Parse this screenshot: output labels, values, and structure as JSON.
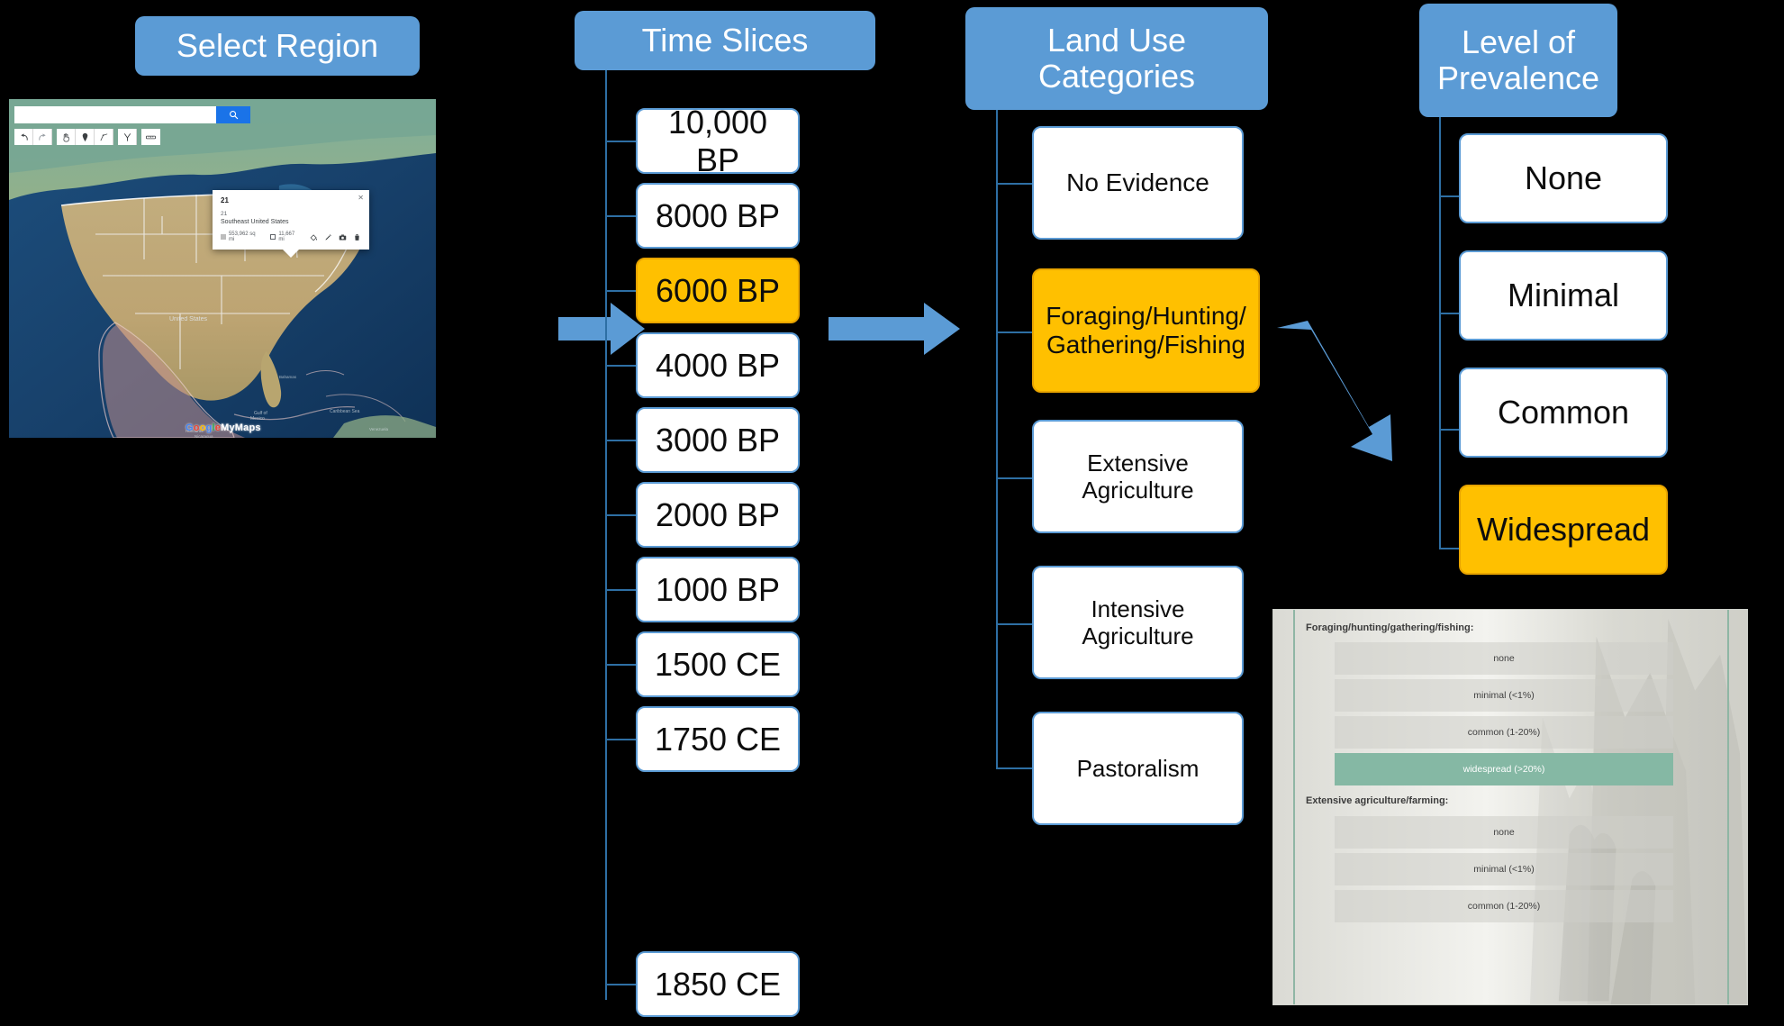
{
  "columns": {
    "region": {
      "header": "Select Region",
      "map": {
        "search_value": "",
        "search_placeholder": "",
        "search_icon": "search-icon",
        "tools": [
          "undo-icon",
          "redo-icon",
          "pan-hand-icon",
          "marker-pin-icon",
          "draw-line-icon",
          "directions-icon",
          "ruler-icon"
        ],
        "popup": {
          "title": "21",
          "subtitle": "21",
          "name": "Southeast United States",
          "area": "553,962 sq mi",
          "perimeter": "11,667 mi",
          "close_icon": "close-icon",
          "action_icons": [
            "paint-bucket-icon",
            "pencil-icon",
            "camera-icon",
            "trash-icon"
          ]
        },
        "watermark": "Google My Maps"
      }
    },
    "time_slices": {
      "header": "Time Slices",
      "items": [
        {
          "label": "10,000 BP",
          "selected": false
        },
        {
          "label": "8000 BP",
          "selected": false
        },
        {
          "label": "6000 BP",
          "selected": true
        },
        {
          "label": "4000 BP",
          "selected": false
        },
        {
          "label": "3000 BP",
          "selected": false
        },
        {
          "label": "2000 BP",
          "selected": false
        },
        {
          "label": "1000 BP",
          "selected": false
        },
        {
          "label": "1500 CE",
          "selected": false
        },
        {
          "label": "1750 CE",
          "selected": false
        },
        {
          "label": "1850 CE",
          "selected": false
        }
      ]
    },
    "land_use": {
      "header": "Land Use Categories",
      "header_line1": "Land Use",
      "header_line2": "Categories",
      "items": [
        {
          "label": "No Evidence",
          "selected": false
        },
        {
          "label": "Foraging/Hunting/Gathering/Fishing",
          "line1": "Foraging/Hunting/",
          "line2": "Gathering/Fishing",
          "selected": true
        },
        {
          "label": "Extensive Agriculture",
          "line1": "Extensive",
          "line2": "Agriculture",
          "selected": false
        },
        {
          "label": "Intensive Agriculture",
          "line1": "Intensive",
          "line2": "Agriculture",
          "selected": false
        },
        {
          "label": "Pastoralism",
          "line1": "Pastoralism",
          "line2": "",
          "selected": false
        }
      ]
    },
    "prevalence": {
      "header": "Level of Prevalence",
      "header_line1": "Level of",
      "header_line2": "Prevalence",
      "items": [
        {
          "label": "None",
          "selected": false
        },
        {
          "label": "Minimal",
          "selected": false
        },
        {
          "label": "Common",
          "selected": false
        },
        {
          "label": "Widespread",
          "selected": true
        }
      ]
    }
  },
  "app_screenshot": {
    "groups": [
      {
        "label": "Foraging/hunting/gathering/fishing:",
        "options": [
          {
            "label": "none",
            "selected": false
          },
          {
            "label": "minimal (<1%)",
            "selected": false
          },
          {
            "label": "common (1-20%)",
            "selected": false
          },
          {
            "label": "widespread (>20%)",
            "selected": true
          }
        ]
      },
      {
        "label": "Extensive agriculture/farming:",
        "options": [
          {
            "label": "none",
            "selected": false
          },
          {
            "label": "minimal (<1%)",
            "selected": false
          },
          {
            "label": "common (1-20%)",
            "selected": false
          }
        ]
      }
    ]
  },
  "colors": {
    "accent_blue": "#5B9BD5",
    "selected_amber": "#FFC000",
    "connector": "#2E6FA4",
    "background": "#000000",
    "app_active_green": "#85B8A4"
  }
}
